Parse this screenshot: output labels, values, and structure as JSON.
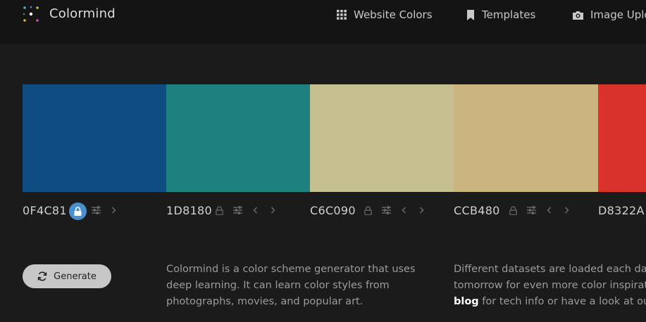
{
  "header": {
    "brand": "Colormind",
    "nav": [
      {
        "label": "Website Colors",
        "icon": "grid-icon"
      },
      {
        "label": "Templates",
        "icon": "bookmark-icon"
      },
      {
        "label": "Image Uplo",
        "icon": "camera-icon"
      }
    ]
  },
  "palette": [
    {
      "hex": "0F4C81",
      "color": "#0F4C81",
      "locked": true
    },
    {
      "hex": "1D8180",
      "color": "#1D8180",
      "locked": false
    },
    {
      "hex": "C6C090",
      "color": "#C6C090",
      "locked": false
    },
    {
      "hex": "CCB480",
      "color": "#CCB480",
      "locked": false
    },
    {
      "hex": "D8322A",
      "color": "#D8322A",
      "locked": false
    }
  ],
  "generate": {
    "label": "Generate"
  },
  "description": {
    "col1": "Colormind is a color scheme generator that uses deep learning. It can learn color styles from photographs, movies, and popular art.",
    "col2_line1": "Different datasets are loaded each day, c",
    "col2_line2": "tomorrow for even more color inspiratic",
    "col2_link": "blog",
    "col2_line3_rest": " for tech info or have a look at our ",
    "col2_line3_end": "A"
  }
}
